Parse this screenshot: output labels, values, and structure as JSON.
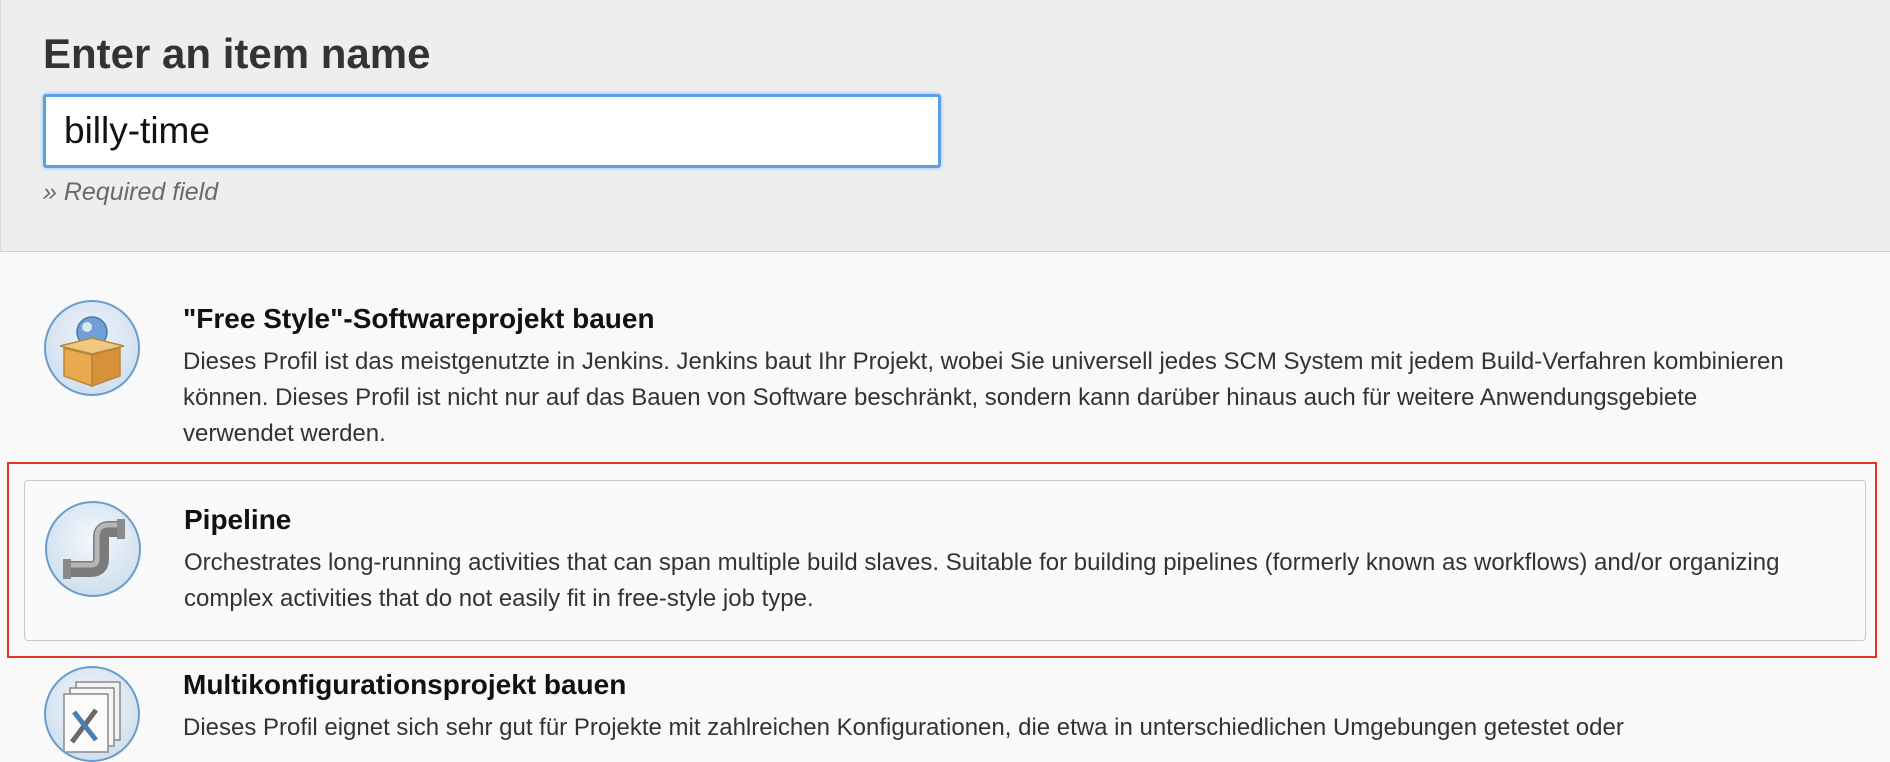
{
  "header": {
    "title": "Enter an item name",
    "input_value": "billy-time",
    "required_label": "» Required field"
  },
  "items": [
    {
      "title": "\"Free Style\"-Softwareprojekt bauen",
      "description": "Dieses Profil ist das meistgenutzte in Jenkins. Jenkins baut Ihr Projekt, wobei Sie universell jedes SCM System mit jedem Build-Verfahren kombinieren können. Dieses Profil ist nicht nur auf das Bauen von Software beschränkt, sondern kann darüber hinaus auch für weitere Anwendungsgebiete verwendet werden.",
      "icon": "freestyle-box-icon",
      "selected": false
    },
    {
      "title": "Pipeline",
      "description": "Orchestrates long-running activities that can span multiple build slaves. Suitable for building pipelines (formerly known as workflows) and/or organizing complex activities that do not easily fit in free-style job type.",
      "icon": "pipe-icon",
      "selected": true
    },
    {
      "title": "Multikonfigurationsprojekt bauen",
      "description": "Dieses Profil eignet sich sehr gut für Projekte mit zahlreichen Konfigurationen, die etwa in unterschiedlichen Umgebungen getestet oder",
      "icon": "multi-config-tools-icon",
      "selected": false
    }
  ],
  "colors": {
    "focus_border": "#5b9fe8",
    "highlight": "#e0352b",
    "header_bg": "#eeeeee"
  }
}
